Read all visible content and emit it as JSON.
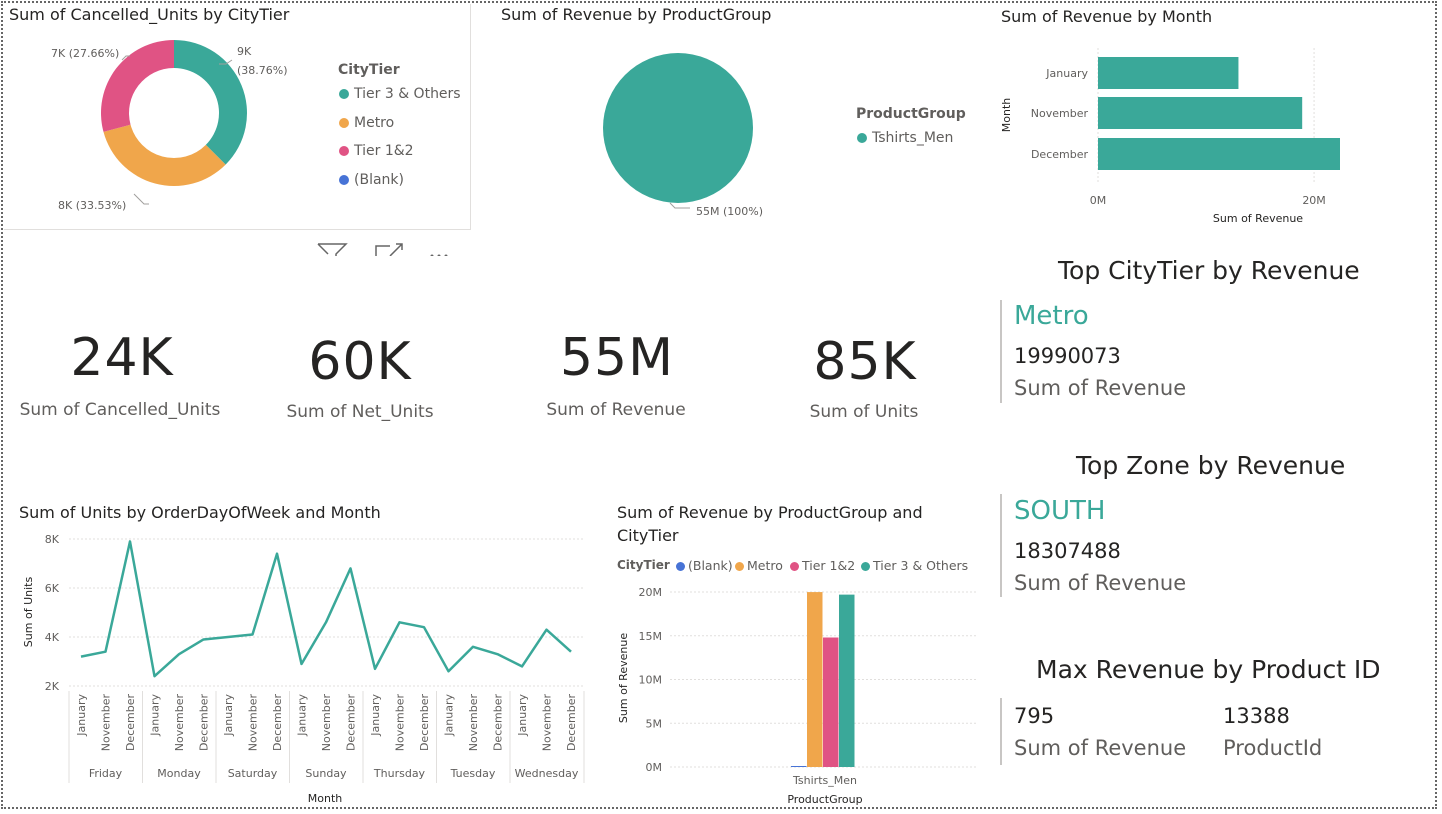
{
  "colors": {
    "teal": "#3aa899",
    "orange": "#f0a64b",
    "pink": "#e05384",
    "blue": "#4773d6",
    "text": "#252423",
    "muted": "#605e5c",
    "grid": "#e1dfdd"
  },
  "donut": {
    "title": "Sum of Cancelled_Units by CityTier",
    "legend_title": "CityTier",
    "labels": [
      "9K",
      "(38.76%)",
      "8K (33.53%)",
      "7K (27.66%)"
    ]
  },
  "pie_product": {
    "title": "Sum of Revenue by ProductGroup",
    "legend_title": "ProductGroup",
    "label": "55M (100%)"
  },
  "month_bar": {
    "title": "Sum of Revenue by Month",
    "ylabel": "Month",
    "xlabel": "Sum of Revenue",
    "ticks": [
      "0M",
      "20M"
    ]
  },
  "cards": [
    {
      "value": "24K",
      "label": "Sum of Cancelled_Units"
    },
    {
      "value": "60K",
      "label": "Sum of Net_Units"
    },
    {
      "value": "55M",
      "label": "Sum of Revenue"
    },
    {
      "value": "85K",
      "label": "Sum of Units"
    }
  ],
  "multirow": {
    "citytier": {
      "title": "Top CityTier by Revenue",
      "category": "Metro",
      "value": "19990073",
      "label": "Sum of Revenue"
    },
    "zone": {
      "title": "Top Zone by Revenue",
      "category": "SOUTH",
      "value": "18307488",
      "label": "Sum of Revenue"
    },
    "product": {
      "title": "Max Revenue by Product ID",
      "value1": "795",
      "label1": "Sum of Revenue",
      "value2": "13388",
      "label2": "ProductId"
    }
  },
  "line": {
    "title": "Sum of Units by OrderDayOfWeek and Month",
    "ylabel": "Sum of Units",
    "xlabel": "Month",
    "yticks": [
      "8K",
      "6K",
      "4K",
      "2K"
    ]
  },
  "cluster": {
    "title_line1": "Sum of Revenue by ProductGroup and",
    "title_line2": "CityTier",
    "legend_title": "CityTier",
    "ylabel": "Sum of Revenue",
    "xlabel": "ProductGroup",
    "yticks": [
      "20M",
      "15M",
      "10M",
      "5M",
      "0M"
    ]
  },
  "chart_data": [
    {
      "type": "pie",
      "title": "Sum of Cancelled_Units by CityTier",
      "donut": true,
      "legend_position": "right",
      "categories": [
        "Tier 3 & Others",
        "Metro",
        "Tier 1&2",
        "(Blank)"
      ],
      "values": [
        9000,
        8000,
        7000,
        0
      ],
      "percent": [
        38.76,
        33.53,
        27.66,
        0
      ],
      "colors": [
        "#3aa899",
        "#f0a64b",
        "#e05384",
        "#4773d6"
      ]
    },
    {
      "type": "pie",
      "title": "Sum of Revenue by ProductGroup",
      "legend_position": "right",
      "categories": [
        "Tshirts_Men"
      ],
      "values": [
        55000000
      ],
      "percent": [
        100
      ],
      "colors": [
        "#3aa899"
      ]
    },
    {
      "type": "bar",
      "orientation": "horizontal",
      "title": "Sum of Revenue by Month",
      "categories": [
        "January",
        "November",
        "December"
      ],
      "values": [
        13000000,
        18900000,
        22400000
      ],
      "xlabel": "Sum of Revenue",
      "ylabel": "Month",
      "xlim": [
        0,
        22400000
      ],
      "xticks": [
        0,
        20000000
      ],
      "color": "#3aa899"
    },
    {
      "type": "line",
      "title": "Sum of Units by OrderDayOfWeek and Month",
      "xlabel": "Month",
      "ylabel": "Sum of Units",
      "ylim": [
        2000,
        8000
      ],
      "yticks": [
        2000,
        4000,
        6000,
        8000
      ],
      "groups": [
        "Friday",
        "Monday",
        "Saturday",
        "Sunday",
        "Thursday",
        "Tuesday",
        "Wednesday"
      ],
      "months": [
        "January",
        "November",
        "December"
      ],
      "series": [
        {
          "values": [
            3200,
            3400,
            7900,
            2400,
            3300,
            3900,
            4000,
            4100,
            7400,
            2900,
            4600,
            6800,
            2700,
            4600,
            4400,
            2600,
            3600,
            3300,
            2800,
            4300,
            3400
          ]
        }
      ],
      "color": "#3aa899"
    },
    {
      "type": "bar",
      "title": "Sum of Revenue by ProductGroup and CityTier",
      "categories": [
        "Tshirts_Men"
      ],
      "xlabel": "ProductGroup",
      "ylabel": "Sum of Revenue",
      "ylim": [
        0,
        20000000
      ],
      "yticks": [
        0,
        5000000,
        10000000,
        15000000,
        20000000
      ],
      "legend_position": "top",
      "series": [
        {
          "name": "(Blank)",
          "values": [
            100000
          ],
          "color": "#4773d6"
        },
        {
          "name": "Metro",
          "values": [
            19990073
          ],
          "color": "#f0a64b"
        },
        {
          "name": "Tier 1&2",
          "values": [
            14800000
          ],
          "color": "#e05384"
        },
        {
          "name": "Tier 3 & Others",
          "values": [
            19700000
          ],
          "color": "#3aa899"
        }
      ]
    }
  ]
}
